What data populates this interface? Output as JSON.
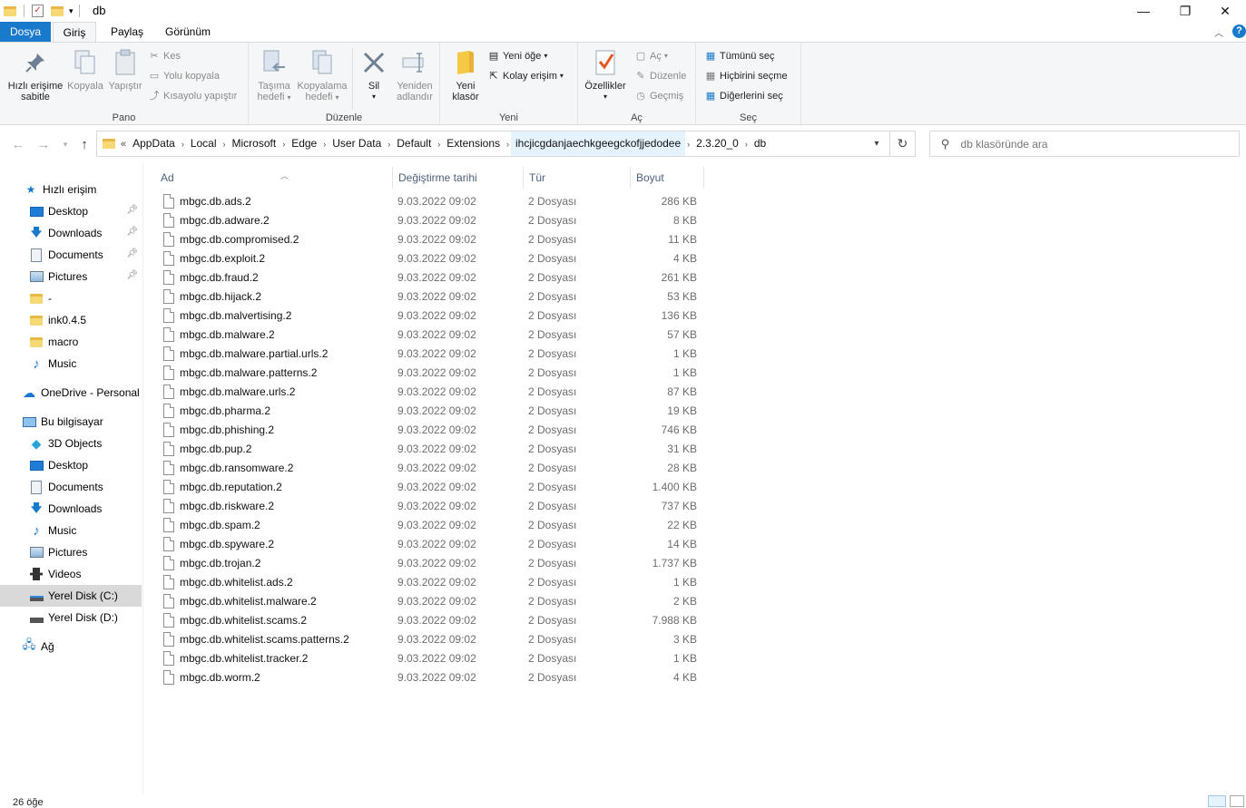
{
  "window": {
    "title": "db",
    "controls": {
      "minimize": "—",
      "maximize": "❐",
      "close": "✕"
    }
  },
  "ribbon": {
    "tabs": [
      "Dosya",
      "Giriş",
      "Paylaş",
      "Görünüm"
    ],
    "groups": {
      "pano": {
        "label": "Pano",
        "pin_line1": "Hızlı erişime",
        "pin_line2": "sabitle",
        "copy": "Kopyala",
        "paste": "Yapıştır",
        "cut": "Kes",
        "copy_path": "Yolu kopyala",
        "paste_shortcut": "Kısayolu yapıştır"
      },
      "duzenle": {
        "label": "Düzenle",
        "move_line1": "Taşıma",
        "move_line2": "hedefi",
        "copyto_line1": "Kopyalama",
        "copyto_line2": "hedefi",
        "delete": "Sil",
        "rename_line1": "Yeniden",
        "rename_line2": "adlandır"
      },
      "yeni": {
        "label": "Yeni",
        "new_folder_line1": "Yeni",
        "new_folder_line2": "klasör",
        "new_item": "Yeni öğe",
        "easy_access": "Kolay erişim"
      },
      "ac": {
        "label": "Aç",
        "properties": "Özellikler",
        "open": "Aç",
        "edit": "Düzenle",
        "history": "Geçmiş"
      },
      "sec": {
        "label": "Seç",
        "select_all": "Tümünü seç",
        "select_none": "Hiçbirini seçme",
        "invert": "Diğerlerini seç"
      }
    }
  },
  "address": {
    "overflow": "«",
    "crumbs": [
      "AppData",
      "Local",
      "Microsoft",
      "Edge",
      "User Data",
      "Default",
      "Extensions",
      "ihcjicgdanjaechkgeegckofjjedodee",
      "2.3.20_0",
      "db"
    ]
  },
  "search": {
    "placeholder": "db klasöründe ara"
  },
  "sidebar": {
    "quick_access": "Hızlı erişim",
    "quick_items": [
      "Desktop",
      "Downloads",
      "Documents",
      "Pictures",
      "-",
      "ink0.4.5",
      "macro",
      "Music"
    ],
    "onedrive": "OneDrive - Personal",
    "this_pc": "Bu bilgisayar",
    "pc_items": [
      "3D Objects",
      "Desktop",
      "Documents",
      "Downloads",
      "Music",
      "Pictures",
      "Videos",
      "Yerel Disk (C:)",
      "Yerel Disk (D:)"
    ],
    "network": "Ağ"
  },
  "columns": {
    "name": "Ad",
    "date": "Değiştirme tarihi",
    "type": "Tür",
    "size": "Boyut"
  },
  "files": [
    {
      "name": "mbgc.db.ads.2",
      "date": "9.03.2022 09:02",
      "type": "2 Dosyası",
      "size": "286 KB"
    },
    {
      "name": "mbgc.db.adware.2",
      "date": "9.03.2022 09:02",
      "type": "2 Dosyası",
      "size": "8 KB"
    },
    {
      "name": "mbgc.db.compromised.2",
      "date": "9.03.2022 09:02",
      "type": "2 Dosyası",
      "size": "11 KB"
    },
    {
      "name": "mbgc.db.exploit.2",
      "date": "9.03.2022 09:02",
      "type": "2 Dosyası",
      "size": "4 KB"
    },
    {
      "name": "mbgc.db.fraud.2",
      "date": "9.03.2022 09:02",
      "type": "2 Dosyası",
      "size": "261 KB"
    },
    {
      "name": "mbgc.db.hijack.2",
      "date": "9.03.2022 09:02",
      "type": "2 Dosyası",
      "size": "53 KB"
    },
    {
      "name": "mbgc.db.malvertising.2",
      "date": "9.03.2022 09:02",
      "type": "2 Dosyası",
      "size": "136 KB"
    },
    {
      "name": "mbgc.db.malware.2",
      "date": "9.03.2022 09:02",
      "type": "2 Dosyası",
      "size": "57 KB"
    },
    {
      "name": "mbgc.db.malware.partial.urls.2",
      "date": "9.03.2022 09:02",
      "type": "2 Dosyası",
      "size": "1 KB"
    },
    {
      "name": "mbgc.db.malware.patterns.2",
      "date": "9.03.2022 09:02",
      "type": "2 Dosyası",
      "size": "1 KB"
    },
    {
      "name": "mbgc.db.malware.urls.2",
      "date": "9.03.2022 09:02",
      "type": "2 Dosyası",
      "size": "87 KB"
    },
    {
      "name": "mbgc.db.pharma.2",
      "date": "9.03.2022 09:02",
      "type": "2 Dosyası",
      "size": "19 KB"
    },
    {
      "name": "mbgc.db.phishing.2",
      "date": "9.03.2022 09:02",
      "type": "2 Dosyası",
      "size": "746 KB"
    },
    {
      "name": "mbgc.db.pup.2",
      "date": "9.03.2022 09:02",
      "type": "2 Dosyası",
      "size": "31 KB"
    },
    {
      "name": "mbgc.db.ransomware.2",
      "date": "9.03.2022 09:02",
      "type": "2 Dosyası",
      "size": "28 KB"
    },
    {
      "name": "mbgc.db.reputation.2",
      "date": "9.03.2022 09:02",
      "type": "2 Dosyası",
      "size": "1.400 KB"
    },
    {
      "name": "mbgc.db.riskware.2",
      "date": "9.03.2022 09:02",
      "type": "2 Dosyası",
      "size": "737 KB"
    },
    {
      "name": "mbgc.db.spam.2",
      "date": "9.03.2022 09:02",
      "type": "2 Dosyası",
      "size": "22 KB"
    },
    {
      "name": "mbgc.db.spyware.2",
      "date": "9.03.2022 09:02",
      "type": "2 Dosyası",
      "size": "14 KB"
    },
    {
      "name": "mbgc.db.trojan.2",
      "date": "9.03.2022 09:02",
      "type": "2 Dosyası",
      "size": "1.737 KB"
    },
    {
      "name": "mbgc.db.whitelist.ads.2",
      "date": "9.03.2022 09:02",
      "type": "2 Dosyası",
      "size": "1 KB"
    },
    {
      "name": "mbgc.db.whitelist.malware.2",
      "date": "9.03.2022 09:02",
      "type": "2 Dosyası",
      "size": "2 KB"
    },
    {
      "name": "mbgc.db.whitelist.scams.2",
      "date": "9.03.2022 09:02",
      "type": "2 Dosyası",
      "size": "7.988 KB"
    },
    {
      "name": "mbgc.db.whitelist.scams.patterns.2",
      "date": "9.03.2022 09:02",
      "type": "2 Dosyası",
      "size": "3 KB"
    },
    {
      "name": "mbgc.db.whitelist.tracker.2",
      "date": "9.03.2022 09:02",
      "type": "2 Dosyası",
      "size": "1 KB"
    },
    {
      "name": "mbgc.db.worm.2",
      "date": "9.03.2022 09:02",
      "type": "2 Dosyası",
      "size": "4 KB"
    }
  ],
  "status": {
    "count": "26 öğe"
  },
  "colors": {
    "accent": "#1979ca",
    "selection": "#cce8ff",
    "folder": "#f8d775"
  }
}
